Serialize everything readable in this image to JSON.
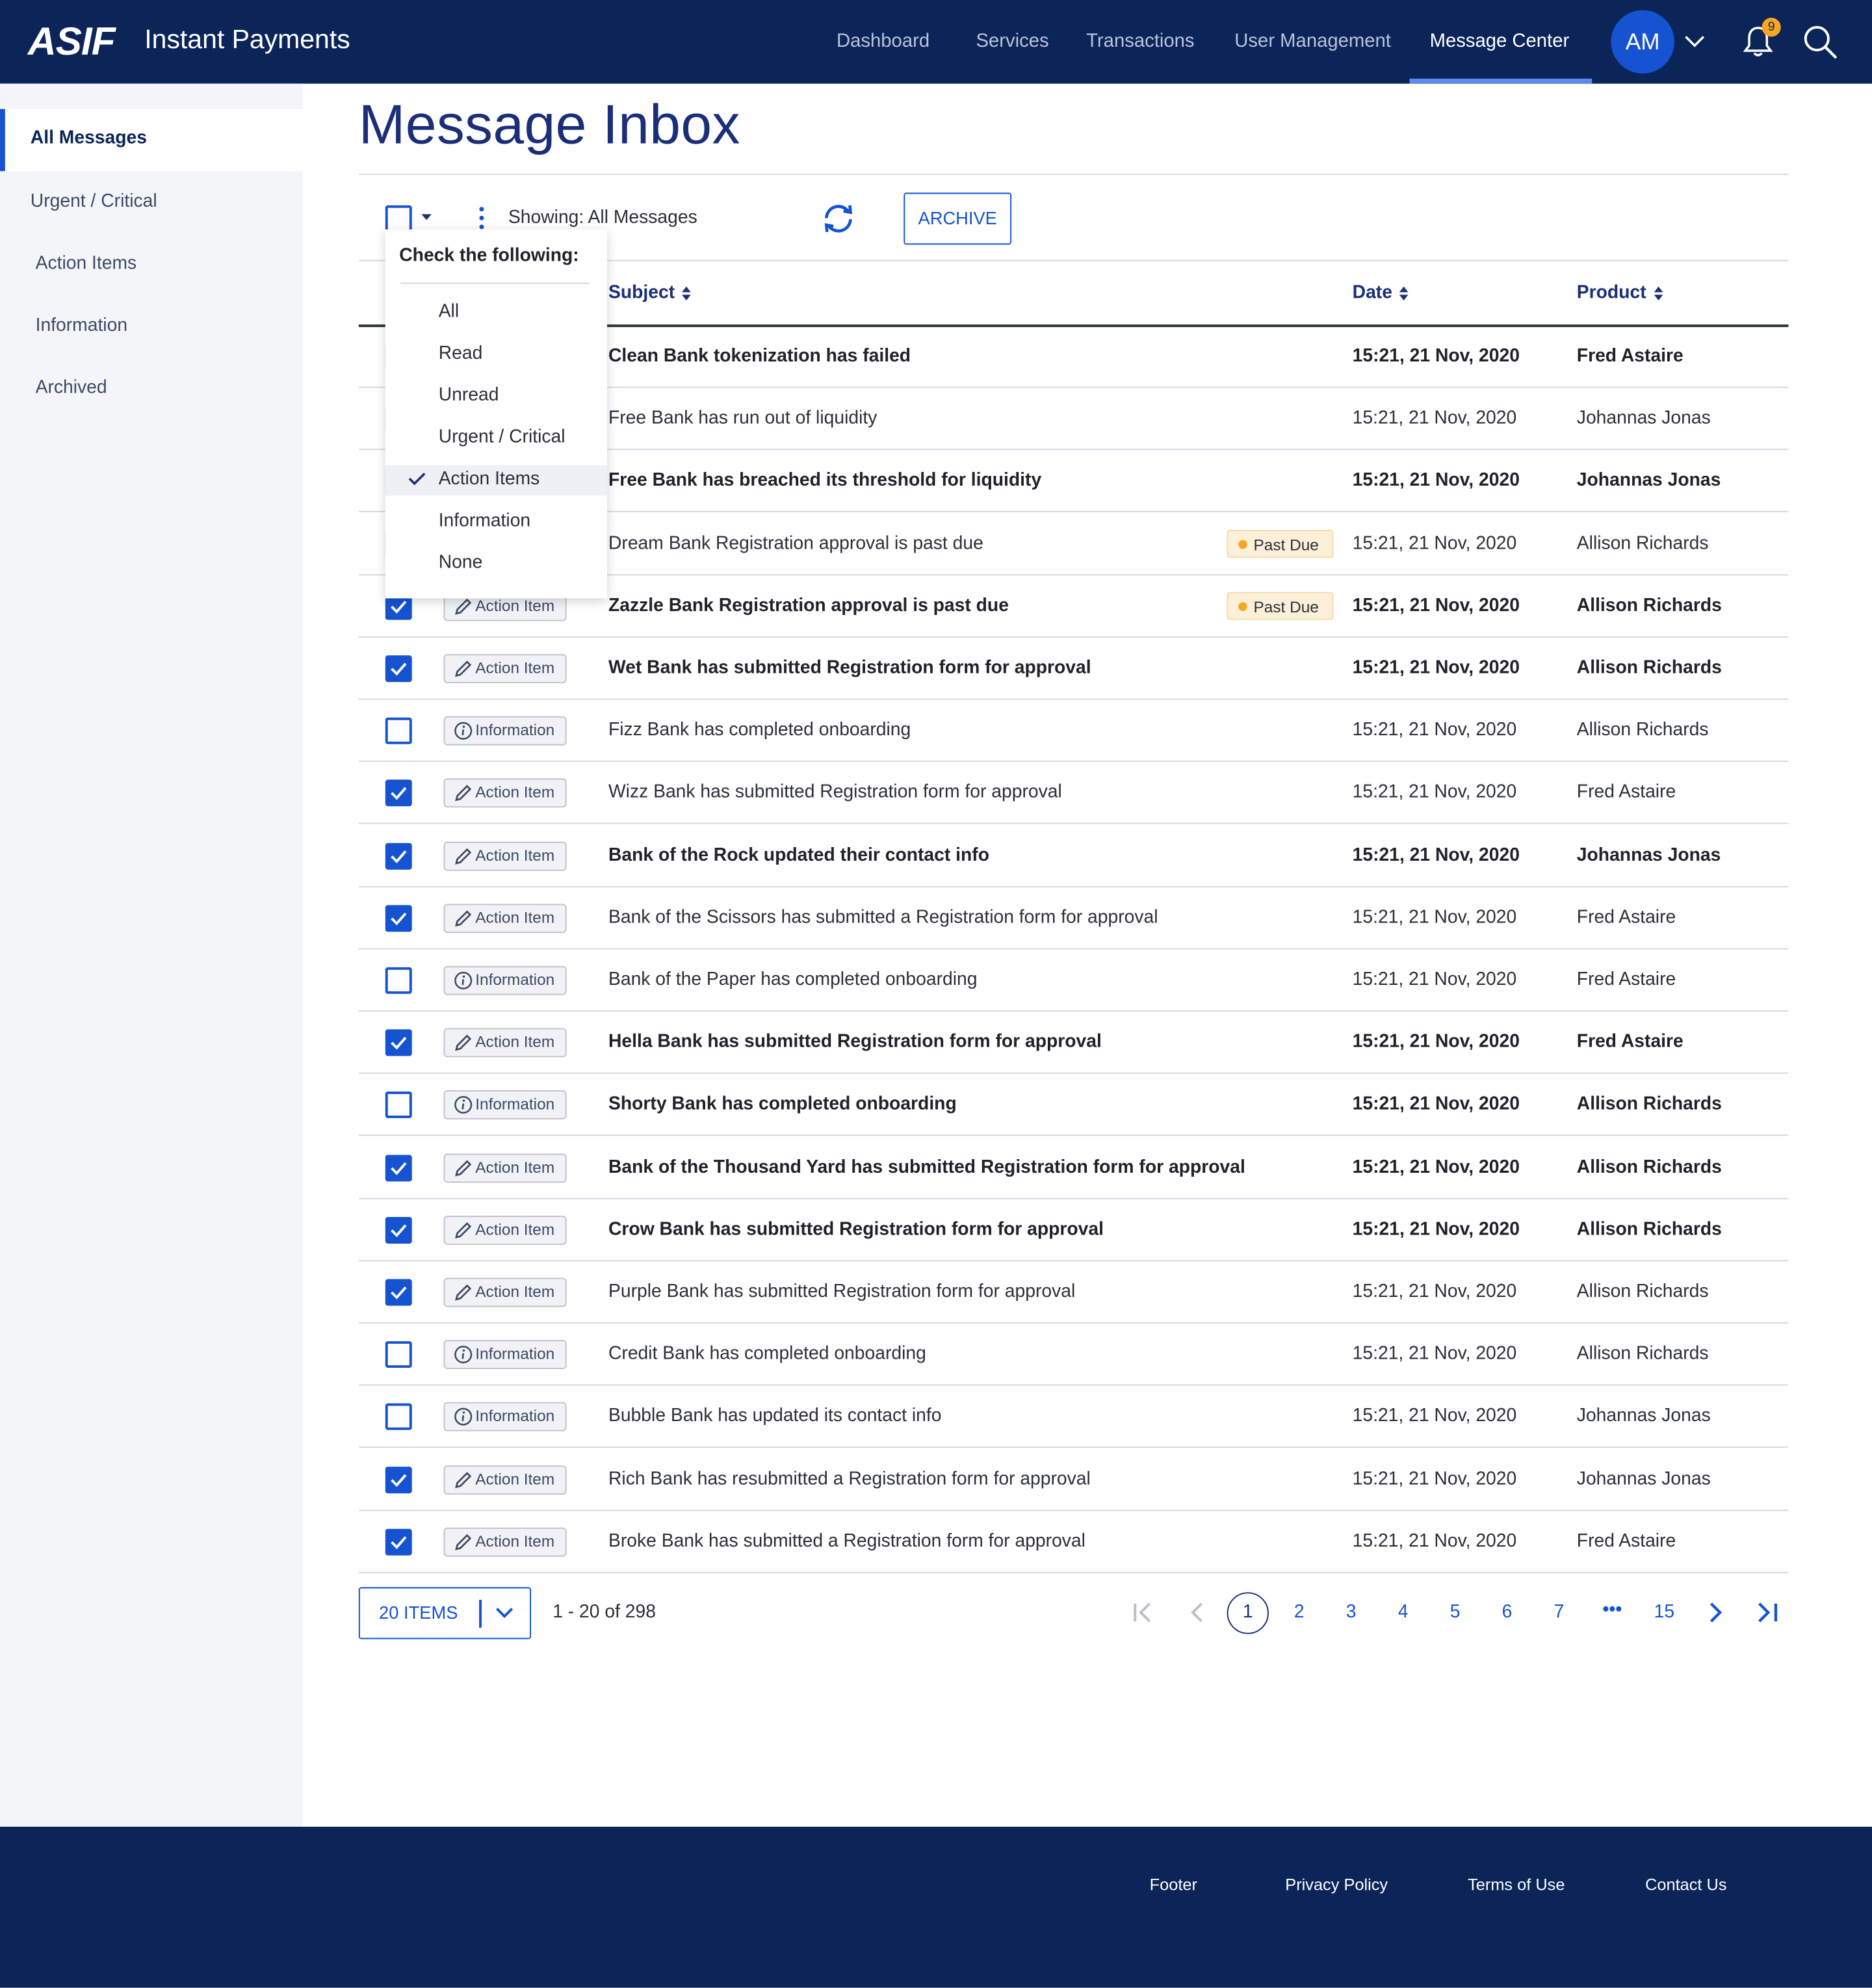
{
  "header": {
    "logo": "ASIF",
    "app_title": "Instant Payments",
    "nav": [
      "Dashboard",
      "Services",
      "Transactions",
      "User Management",
      "Message Center"
    ],
    "active_nav": "Message Center",
    "avatar_initials": "AM",
    "notification_count": "9"
  },
  "sidebar": {
    "items": [
      "All Messages",
      "Urgent / Critical",
      "Action Items",
      "Information",
      "Archived"
    ],
    "active": "All Messages"
  },
  "page": {
    "title": "Message Inbox",
    "showing_label": "Showing: All Messages",
    "archive_label": "ARCHIVE"
  },
  "table": {
    "columns": {
      "subject": "Subject",
      "date": "Date",
      "product": "Product"
    },
    "rows": [
      {
        "checked": false,
        "tag": "",
        "subject": "Clean Bank tokenization has failed",
        "badge": "",
        "date": "15:21, 21 Nov, 2020",
        "product": "Fred Astaire",
        "bold": true
      },
      {
        "checked": false,
        "tag": "",
        "subject": "Free Bank has run out of liquidity",
        "badge": "",
        "date": "15:21, 21 Nov, 2020",
        "product": "Johannas Jonas",
        "bold": false
      },
      {
        "checked": false,
        "tag": "",
        "subject": "Free Bank has breached its threshold for liquidity",
        "badge": "",
        "date": "15:21, 21 Nov, 2020",
        "product": "Johannas Jonas",
        "bold": true
      },
      {
        "checked": false,
        "tag": "",
        "subject": "Dream Bank Registration approval is past due",
        "badge": "Past Due",
        "date": "15:21, 21 Nov, 2020",
        "product": "Allison Richards",
        "bold": false
      },
      {
        "checked": true,
        "tag": "Action Item",
        "subject": "Zazzle Bank Registration approval is past due",
        "badge": "Past Due",
        "date": "15:21, 21 Nov, 2020",
        "product": "Allison Richards",
        "bold": true
      },
      {
        "checked": true,
        "tag": "Action Item",
        "subject": "Wet Bank has submitted Registration form for approval",
        "badge": "",
        "date": "15:21, 21 Nov, 2020",
        "product": "Allison Richards",
        "bold": true
      },
      {
        "checked": false,
        "tag": "Information",
        "subject": "Fizz Bank has completed onboarding",
        "badge": "",
        "date": "15:21, 21 Nov, 2020",
        "product": "Allison Richards",
        "bold": false
      },
      {
        "checked": true,
        "tag": "Action Item",
        "subject": "Wizz Bank has submitted Registration form for approval",
        "badge": "",
        "date": "15:21, 21 Nov, 2020",
        "product": "Fred Astaire",
        "bold": false
      },
      {
        "checked": true,
        "tag": "Action Item",
        "subject": "Bank of the Rock updated their contact info",
        "badge": "",
        "date": "15:21, 21 Nov, 2020",
        "product": "Johannas Jonas",
        "bold": true
      },
      {
        "checked": true,
        "tag": "Action Item",
        "subject": "Bank of the Scissors has submitted a Registration form for approval",
        "badge": "",
        "date": "15:21, 21 Nov, 2020",
        "product": "Fred Astaire",
        "bold": false
      },
      {
        "checked": false,
        "tag": "Information",
        "subject": "Bank of the Paper has completed onboarding",
        "badge": "",
        "date": "15:21, 21 Nov, 2020",
        "product": "Fred Astaire",
        "bold": false
      },
      {
        "checked": true,
        "tag": "Action Item",
        "subject": "Hella Bank has submitted Registration form for approval",
        "badge": "",
        "date": "15:21, 21 Nov, 2020",
        "product": "Fred Astaire",
        "bold": true
      },
      {
        "checked": false,
        "tag": "Information",
        "subject": "Shorty Bank has completed onboarding",
        "badge": "",
        "date": "15:21, 21 Nov, 2020",
        "product": "Allison Richards",
        "bold": true
      },
      {
        "checked": true,
        "tag": "Action Item",
        "subject": "Bank of the Thousand Yard has submitted Registration form for approval",
        "badge": "",
        "date": "15:21, 21 Nov, 2020",
        "product": "Allison Richards",
        "bold": true
      },
      {
        "checked": true,
        "tag": "Action Item",
        "subject": "Crow Bank has submitted Registration form for approval",
        "badge": "",
        "date": "15:21, 21 Nov, 2020",
        "product": "Allison Richards",
        "bold": true
      },
      {
        "checked": true,
        "tag": "Action Item",
        "subject": "Purple Bank has submitted Registration form for approval",
        "badge": "",
        "date": "15:21, 21 Nov, 2020",
        "product": "Allison Richards",
        "bold": false
      },
      {
        "checked": false,
        "tag": "Information",
        "subject": "Credit Bank has completed onboarding",
        "badge": "",
        "date": "15:21, 21 Nov, 2020",
        "product": "Allison Richards",
        "bold": false
      },
      {
        "checked": false,
        "tag": "Information",
        "subject": "Bubble Bank has updated its contact info",
        "badge": "",
        "date": "15:21, 21 Nov, 2020",
        "product": "Johannas Jonas",
        "bold": false
      },
      {
        "checked": true,
        "tag": "Action Item",
        "subject": "Rich Bank has resubmitted a Registration form for approval",
        "badge": "",
        "date": "15:21, 21 Nov, 2020",
        "product": "Johannas Jonas",
        "bold": false
      },
      {
        "checked": true,
        "tag": "Action Item",
        "subject": "Broke Bank has submitted a Registration form for approval",
        "badge": "",
        "date": "15:21, 21 Nov, 2020",
        "product": "Fred Astaire",
        "bold": false
      }
    ]
  },
  "dropdown": {
    "heading": "Check the following:",
    "options": [
      "All",
      "Read",
      "Unread",
      "Urgent / Critical",
      "Action Items",
      "Information",
      "None"
    ],
    "selected": "Action Items"
  },
  "pagination": {
    "page_size_label": "20 ITEMS",
    "range_label": "1 - 20 of 298",
    "pages": [
      "1",
      "2",
      "3",
      "4",
      "5",
      "6",
      "7",
      "•••",
      "15"
    ],
    "current_page": "1"
  },
  "footer": {
    "links": [
      "Footer",
      "Privacy Policy",
      "Terms of Use",
      "Contact Us"
    ]
  },
  "colors": {
    "navy": "#0b2559",
    "accent": "#1553d1",
    "badge_orange": "#f6a623"
  }
}
